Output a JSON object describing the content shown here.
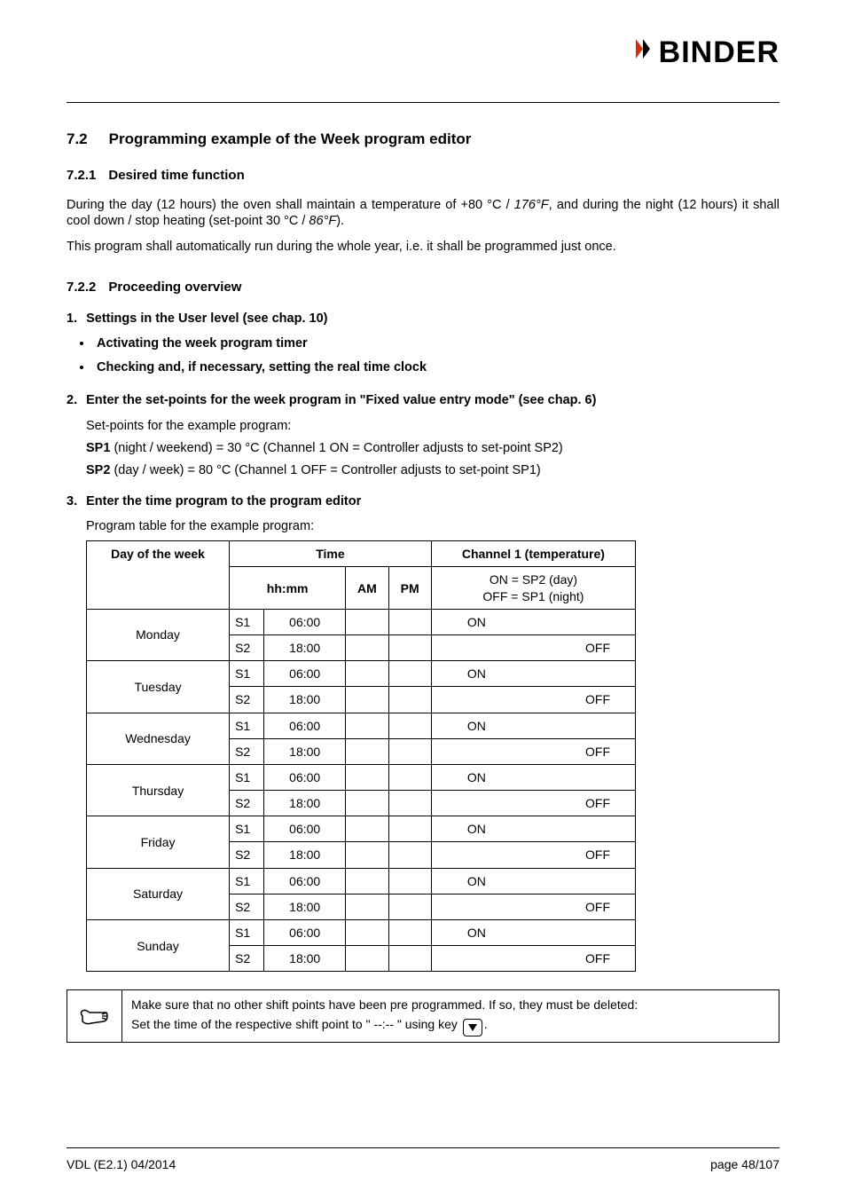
{
  "brand": "BINDER",
  "section": {
    "num": "7.2",
    "title": "Programming example of the Week program editor"
  },
  "sub721": {
    "num": "7.2.1",
    "title": "Desired time function",
    "p1a": "During the day (12 hours) the oven shall maintain a temperature of +80 °C / ",
    "p1b": "176°F",
    "p1c": ", and during the night (12 hours) it shall cool down / stop heating (set-point 30 °C / ",
    "p1d": "86°F",
    "p1e": ").",
    "p2": "This program shall automatically run during the whole year, i.e. it shall be programmed just once."
  },
  "sub722": {
    "num": "7.2.2",
    "title": "Proceeding overview"
  },
  "step1": {
    "num": "1.",
    "title": "Settings in the User level (see chap. 10)",
    "b1": "Activating the week program timer",
    "b2": "Checking and, if necessary, setting the real time clock"
  },
  "step2": {
    "num": "2.",
    "title": "Enter the set-points for the week program in \"Fixed value entry mode\" (see chap. 6)",
    "intro": "Set-points for the example program:",
    "sp1label": "SP1",
    "sp1text": " (night / weekend) = 30 °C (Channel 1 ON = Controller adjusts to set-point SP2)",
    "sp2label": "SP2",
    "sp2text": " (day / week) = 80 °C (Channel 1 OFF = Controller adjusts to set-point SP1)"
  },
  "step3": {
    "num": "3.",
    "title": "Enter the time program to the program editor",
    "intro": "Program table for the example program:"
  },
  "table": {
    "h_day": "Day of the week",
    "h_time": "Time",
    "h_ch1": "Channel 1 (temperature)",
    "h_hhmm": "hh:mm",
    "h_am": "AM",
    "h_pm": "PM",
    "h_on": "ON = SP2 (day)",
    "h_off": "OFF = SP1 (night)",
    "rows": [
      {
        "day": "Monday",
        "s1": "S1",
        "t1": "06:00",
        "c1": "ON",
        "s2": "S2",
        "t2": "18:00",
        "c2": "OFF"
      },
      {
        "day": "Tuesday",
        "s1": "S1",
        "t1": "06:00",
        "c1": "ON",
        "s2": "S2",
        "t2": "18:00",
        "c2": "OFF"
      },
      {
        "day": "Wednesday",
        "s1": "S1",
        "t1": "06:00",
        "c1": "ON",
        "s2": "S2",
        "t2": "18:00",
        "c2": "OFF"
      },
      {
        "day": "Thursday",
        "s1": "S1",
        "t1": "06:00",
        "c1": "ON",
        "s2": "S2",
        "t2": "18:00",
        "c2": "OFF"
      },
      {
        "day": "Friday",
        "s1": "S1",
        "t1": "06:00",
        "c1": "ON",
        "s2": "S2",
        "t2": "18:00",
        "c2": "OFF"
      },
      {
        "day": "Saturday",
        "s1": "S1",
        "t1": "06:00",
        "c1": "ON",
        "s2": "S2",
        "t2": "18:00",
        "c2": "OFF"
      },
      {
        "day": "Sunday",
        "s1": "S1",
        "t1": "06:00",
        "c1": "ON",
        "s2": "S2",
        "t2": "18:00",
        "c2": "OFF"
      }
    ]
  },
  "note": {
    "l1": "Make sure that no other shift points have been pre programmed. If so, they must be deleted:",
    "l2a": "Set the time of the respective shift point to \" --:-- \" using key ",
    "l2b": "."
  },
  "footer": {
    "left": "VDL (E2.1) 04/2014",
    "right": "page 48/107"
  }
}
